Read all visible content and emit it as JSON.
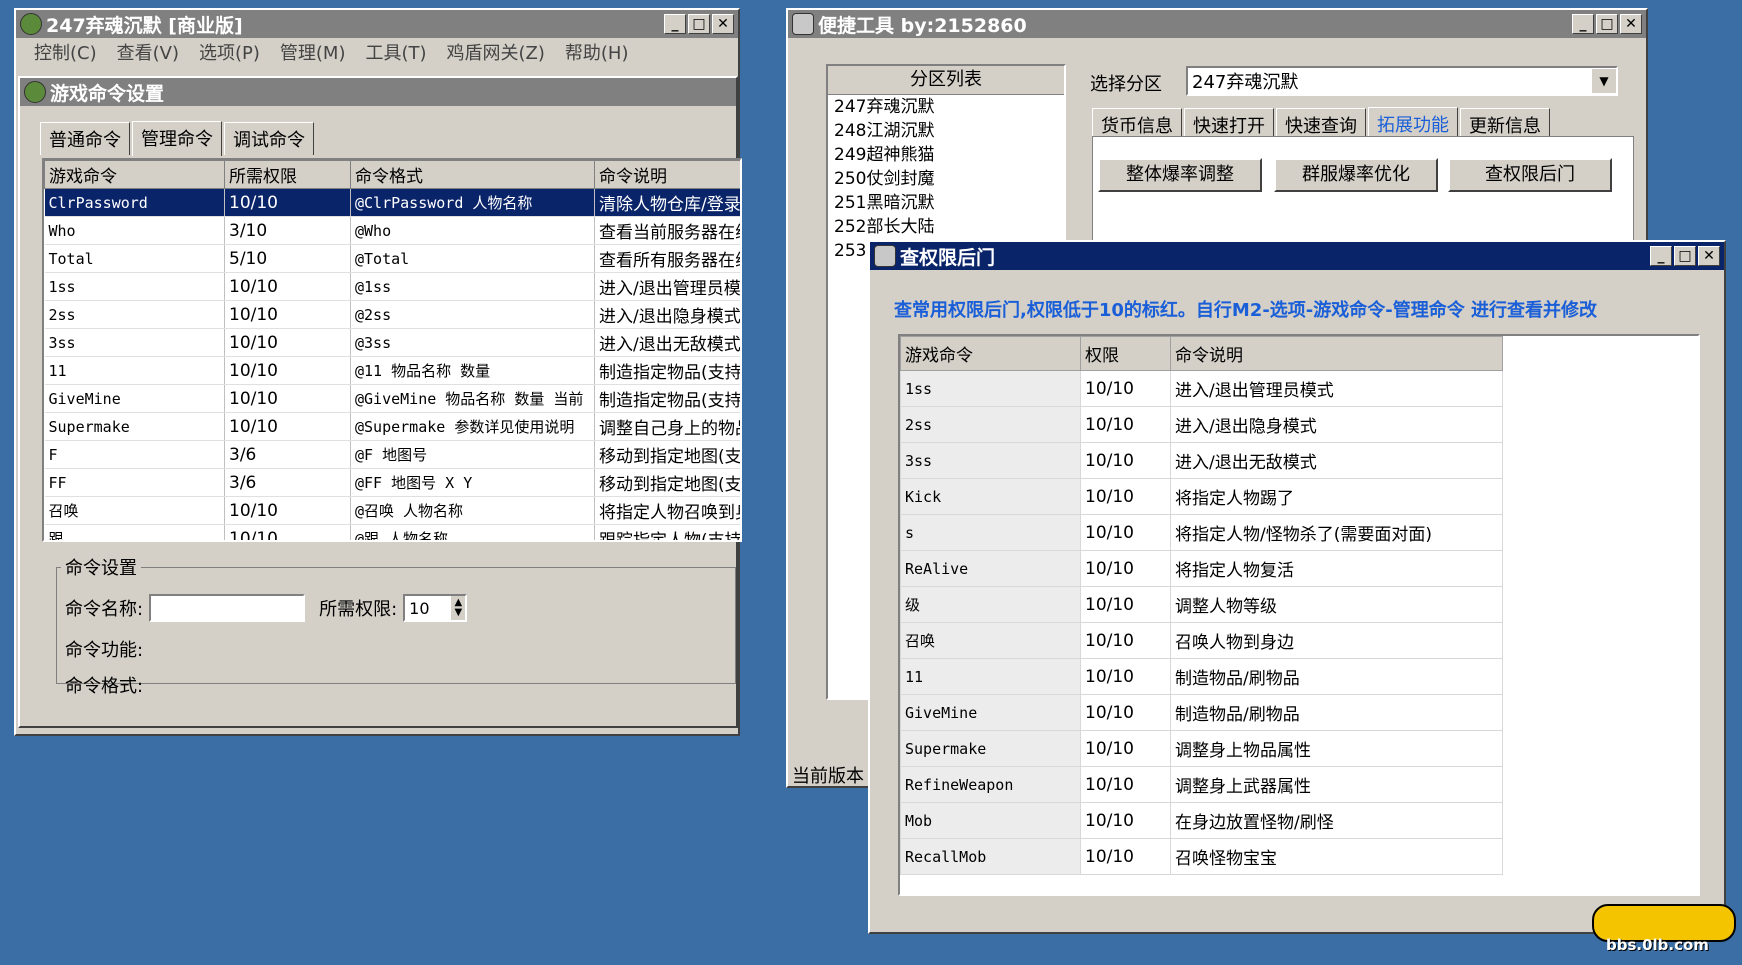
{
  "main_window": {
    "title": "247弃魂沉默 [商业版]",
    "menu": [
      "控制(C)",
      "查看(V)",
      "选项(P)",
      "管理(M)",
      "工具(T)",
      "鸡盾网关(Z)",
      "帮助(H)"
    ]
  },
  "cmd_settings": {
    "title": "游戏命令设置",
    "tabs": [
      "普通命令",
      "管理命令",
      "调试命令"
    ],
    "columns": [
      "游戏命令",
      "所需权限",
      "命令格式",
      "命令说明"
    ],
    "rows": [
      {
        "cmd": "ClrPassword",
        "perm": "10/10",
        "format": "@ClrPassword 人物名称",
        "desc": "清除人物仓库/登录密码"
      },
      {
        "cmd": "Who",
        "perm": "3/10",
        "format": "@Who",
        "desc": "查看当前服务器在线人数"
      },
      {
        "cmd": "Total",
        "perm": "5/10",
        "format": "@Total",
        "desc": "查看所有服务器在线人数"
      },
      {
        "cmd": "1ss",
        "perm": "10/10",
        "format": "@1ss",
        "desc": "进入/退出管理员模式(进入"
      },
      {
        "cmd": "2ss",
        "perm": "10/10",
        "format": "@2ss",
        "desc": "进入/退出隐身模式(进入"
      },
      {
        "cmd": "3ss",
        "perm": "10/10",
        "format": "@3ss",
        "desc": "进入/退出无敌模式(进入"
      },
      {
        "cmd": "11",
        "perm": "10/10",
        "format": "@11 物品名称 数量",
        "desc": "制造指定物品(支持权限"
      },
      {
        "cmd": "GiveMine",
        "perm": "10/10",
        "format": "@GiveMine 物品名称 数量 当前",
        "desc": "制造指定物品(支持权限"
      },
      {
        "cmd": "Supermake",
        "perm": "10/10",
        "format": "@Supermake 参数详见使用说明",
        "desc": "调整自己身上的物品属性"
      },
      {
        "cmd": "F",
        "perm": "3/6",
        "format": "@F 地图号",
        "desc": "移动到指定地图(支持权限"
      },
      {
        "cmd": "FF",
        "perm": "3/6",
        "format": "@FF 地图号 X Y",
        "desc": "移动到指定地图(支持权限"
      },
      {
        "cmd": "召唤",
        "perm": "10/10",
        "format": "@召唤 人物名称",
        "desc": "将指定人物召唤到身边(支"
      },
      {
        "cmd": "跟",
        "perm": "10/10",
        "format": "@跟 人物名称",
        "desc": "跟踪指定人物(支持权限"
      }
    ],
    "group_label": "命令设置",
    "name_label": "命令名称:",
    "name_value": "",
    "perm_label": "所需权限:",
    "perm_value": "10",
    "func_label": "命令功能:",
    "format_label": "命令格式:"
  },
  "quick_tool": {
    "title": "便捷工具  by:2152860",
    "zone_list_header": "分区列表",
    "zones": [
      "247弃魂沉默",
      "248江湖沉默",
      "249超神熊猫",
      "250仗剑封魔",
      "251黑暗沉默",
      "252部长大陆",
      "253"
    ],
    "select_label": "选择分区",
    "select_value": "247弃魂沉默",
    "tabs": [
      "货币信息",
      "快速打开",
      "快速查询",
      "拓展功能",
      "更新信息"
    ],
    "buttons": [
      "整体爆率调整",
      "群服爆率优化",
      "查权限后门"
    ],
    "version_label": "当前版本"
  },
  "backdoor": {
    "title": "查权限后门",
    "notice": "查常用权限后门,权限低于10的标红。自行M2-选项-游戏命令-管理命令 进行查看并修改",
    "columns": [
      "游戏命令",
      "权限",
      "命令说明"
    ],
    "rows": [
      {
        "cmd": "1ss",
        "perm": "10/10",
        "desc": "进入/退出管理员模式"
      },
      {
        "cmd": "2ss",
        "perm": "10/10",
        "desc": "进入/退出隐身模式"
      },
      {
        "cmd": "3ss",
        "perm": "10/10",
        "desc": "进入/退出无敌模式"
      },
      {
        "cmd": "Kick",
        "perm": "10/10",
        "desc": "将指定人物踢了"
      },
      {
        "cmd": "s",
        "perm": "10/10",
        "desc": "将指定人物/怪物杀了(需要面对面)"
      },
      {
        "cmd": "ReAlive",
        "perm": "10/10",
        "desc": "将指定人物复活"
      },
      {
        "cmd": "级",
        "perm": "10/10",
        "desc": "调整人物等级"
      },
      {
        "cmd": "召唤",
        "perm": "10/10",
        "desc": "召唤人物到身边"
      },
      {
        "cmd": "11",
        "perm": "10/10",
        "desc": "制造物品/刷物品"
      },
      {
        "cmd": "GiveMine",
        "perm": "10/10",
        "desc": "制造物品/刷物品"
      },
      {
        "cmd": "Supermake",
        "perm": "10/10",
        "desc": "调整身上物品属性"
      },
      {
        "cmd": "RefineWeapon",
        "perm": "10/10",
        "desc": "调整身上武器属性"
      },
      {
        "cmd": "Mob",
        "perm": "10/10",
        "desc": "在身边放置怪物/刷怪"
      },
      {
        "cmd": "RecallMob",
        "perm": "10/10",
        "desc": "召唤怪物宝宝"
      }
    ]
  },
  "watermark": "bbs.0lb.com",
  "colors": {
    "accent": "#1a5fd8",
    "selection": "#0a246a",
    "desktop": "#3a6ea5"
  }
}
